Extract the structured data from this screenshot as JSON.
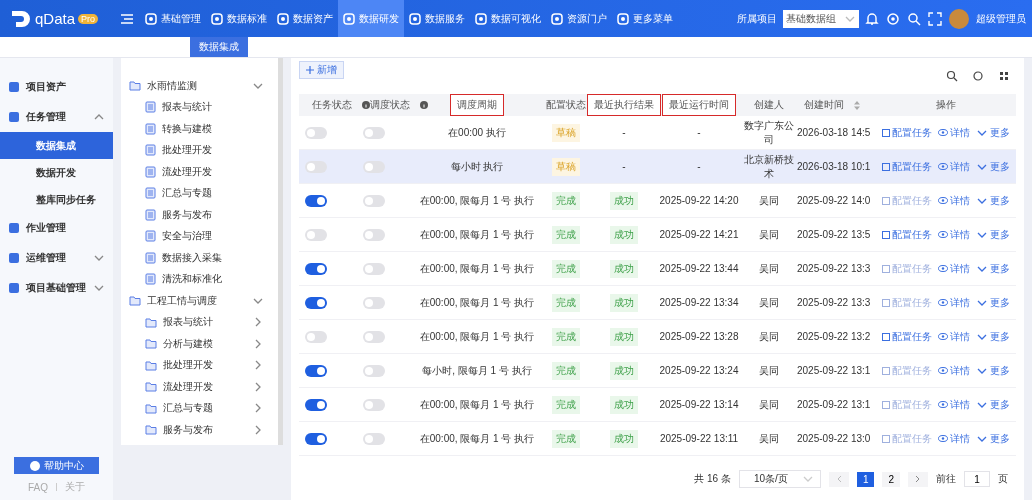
{
  "topbar": {
    "logo": "qData",
    "badge": "Pro",
    "menu": [
      {
        "label": "基础管理",
        "selected": false
      },
      {
        "label": "数据标准",
        "selected": false
      },
      {
        "label": "数据资产",
        "selected": false
      },
      {
        "label": "数据研发",
        "selected": true
      },
      {
        "label": "数据服务",
        "selected": false
      },
      {
        "label": "数据可视化",
        "selected": false
      },
      {
        "label": "资源门户",
        "selected": false
      },
      {
        "label": "更多菜单",
        "selected": false
      }
    ],
    "project_label": "所属项目",
    "project_value": "基础数据组",
    "user": "超级管理员"
  },
  "tabs": [
    {
      "label": "数据集成",
      "selected": true
    }
  ],
  "sidebar": {
    "items": [
      {
        "label": "项目资产"
      },
      {
        "label": "任务管理",
        "expanded": true,
        "children": [
          {
            "label": "数据集成",
            "selected": true
          },
          {
            "label": "数据开发",
            "selected": false
          },
          {
            "label": "整库同步任务",
            "selected": false
          }
        ]
      },
      {
        "label": "作业管理"
      },
      {
        "label": "运维管理",
        "expanded": false
      },
      {
        "label": "项目基础管理",
        "expanded": false
      }
    ],
    "help_button": "帮助中心",
    "links": [
      "FAQ",
      "关于"
    ]
  },
  "tree": [
    {
      "label": "水雨情监测",
      "kind": "folder",
      "expanded": true,
      "children": [
        {
          "label": "报表与统计",
          "kind": "file"
        },
        {
          "label": "转换与建模",
          "kind": "file"
        },
        {
          "label": "批处理开发",
          "kind": "file"
        },
        {
          "label": "流处理开发",
          "kind": "file"
        },
        {
          "label": "汇总与专题",
          "kind": "file"
        },
        {
          "label": "服务与发布",
          "kind": "file"
        },
        {
          "label": "安全与治理",
          "kind": "file"
        },
        {
          "label": "数据接入采集",
          "kind": "file"
        },
        {
          "label": "清洗和标准化",
          "kind": "file"
        }
      ]
    },
    {
      "label": "工程工情与调度",
      "kind": "folder",
      "expanded": true,
      "children": [
        {
          "label": "报表与统计",
          "kind": "folder",
          "expanded": false
        },
        {
          "label": "分析与建模",
          "kind": "folder",
          "expanded": false
        },
        {
          "label": "批处理开发",
          "kind": "folder",
          "expanded": false
        },
        {
          "label": "流处理开发",
          "kind": "folder",
          "expanded": false
        },
        {
          "label": "汇总与专题",
          "kind": "folder",
          "expanded": false
        },
        {
          "label": "服务与发布",
          "kind": "folder",
          "expanded": false
        }
      ]
    }
  ],
  "add_button": "新增",
  "table": {
    "columns": [
      {
        "label": "任务状态",
        "info": true,
        "highlighted": false
      },
      {
        "label": "调度状态",
        "info": true,
        "highlighted": false
      },
      {
        "label": "调度周期",
        "highlighted": true
      },
      {
        "label": "配置状态",
        "highlighted": false
      },
      {
        "label": "最近执行结果",
        "highlighted": true
      },
      {
        "label": "最近运行时间",
        "highlighted": true
      },
      {
        "label": "创建人",
        "highlighted": false
      },
      {
        "label": "创建时间",
        "sortable": true,
        "highlighted": false
      },
      {
        "label": "操作",
        "highlighted": false
      }
    ],
    "rows": [
      {
        "selected": false,
        "task_on": false,
        "schedule_on": false,
        "period": "在00:00 执行",
        "config": {
          "text": "草稿",
          "kind": "draft"
        },
        "result": {
          "text": "-",
          "tagged": false
        },
        "run_time": "-",
        "creator": "数字广东公司",
        "created": "2026-03-18 14:5",
        "actions": [
          {
            "label": "配置任务",
            "disabled": false
          },
          {
            "label": "详情"
          },
          {
            "label": "更多"
          }
        ]
      },
      {
        "selected": true,
        "task_on": false,
        "schedule_on": false,
        "period": "每小时 执行",
        "config": {
          "text": "草稿",
          "kind": "draft"
        },
        "result": {
          "text": "-",
          "tagged": false
        },
        "run_time": "-",
        "creator": "北京新桥技术",
        "created": "2026-03-18 10:1",
        "actions": [
          {
            "label": "配置任务",
            "disabled": false
          },
          {
            "label": "详情"
          },
          {
            "label": "更多"
          }
        ]
      },
      {
        "selected": false,
        "task_on": true,
        "schedule_on": false,
        "period": "在00:00, 限每月 1 号 执行",
        "config": {
          "text": "完成",
          "kind": "done"
        },
        "result": {
          "text": "成功",
          "tagged": true
        },
        "run_time": "2025-09-22 14:20",
        "creator": "吴同",
        "created": "2025-09-22 14:0",
        "actions": [
          {
            "label": "配置任务",
            "disabled": true
          },
          {
            "label": "详情"
          },
          {
            "label": "更多"
          }
        ]
      },
      {
        "selected": false,
        "task_on": false,
        "schedule_on": false,
        "period": "在00:00, 限每月 1 号 执行",
        "config": {
          "text": "完成",
          "kind": "done"
        },
        "result": {
          "text": "成功",
          "tagged": true
        },
        "run_time": "2025-09-22 14:21",
        "creator": "吴同",
        "created": "2025-09-22 13:5",
        "actions": [
          {
            "label": "配置任务",
            "disabled": false
          },
          {
            "label": "详情"
          },
          {
            "label": "更多"
          }
        ]
      },
      {
        "selected": false,
        "task_on": true,
        "schedule_on": false,
        "period": "在00:00, 限每月 1 号 执行",
        "config": {
          "text": "完成",
          "kind": "done"
        },
        "result": {
          "text": "成功",
          "tagged": true
        },
        "run_time": "2025-09-22 13:44",
        "creator": "吴同",
        "created": "2025-09-22 13:3",
        "actions": [
          {
            "label": "配置任务",
            "disabled": true
          },
          {
            "label": "详情"
          },
          {
            "label": "更多"
          }
        ]
      },
      {
        "selected": false,
        "task_on": true,
        "schedule_on": false,
        "period": "在00:00, 限每月 1 号 执行",
        "config": {
          "text": "完成",
          "kind": "done"
        },
        "result": {
          "text": "成功",
          "tagged": true
        },
        "run_time": "2025-09-22 13:34",
        "creator": "吴同",
        "created": "2025-09-22 13:3",
        "actions": [
          {
            "label": "配置任务",
            "disabled": true
          },
          {
            "label": "详情"
          },
          {
            "label": "更多"
          }
        ]
      },
      {
        "selected": false,
        "task_on": false,
        "schedule_on": false,
        "period": "在00:00, 限每月 1 号 执行",
        "config": {
          "text": "完成",
          "kind": "done"
        },
        "result": {
          "text": "成功",
          "tagged": true
        },
        "run_time": "2025-09-22 13:28",
        "creator": "吴同",
        "created": "2025-09-22 13:2",
        "actions": [
          {
            "label": "配置任务",
            "disabled": false
          },
          {
            "label": "详情"
          },
          {
            "label": "更多"
          }
        ]
      },
      {
        "selected": false,
        "task_on": true,
        "schedule_on": false,
        "period": "每小时, 限每月 1 号 执行",
        "config": {
          "text": "完成",
          "kind": "done"
        },
        "result": {
          "text": "成功",
          "tagged": true
        },
        "run_time": "2025-09-22 13:24",
        "creator": "吴同",
        "created": "2025-09-22 13:1",
        "actions": [
          {
            "label": "配置任务",
            "disabled": true
          },
          {
            "label": "详情"
          },
          {
            "label": "更多"
          }
        ]
      },
      {
        "selected": false,
        "task_on": true,
        "schedule_on": false,
        "period": "在00:00, 限每月 1 号 执行",
        "config": {
          "text": "完成",
          "kind": "done"
        },
        "result": {
          "text": "成功",
          "tagged": true
        },
        "run_time": "2025-09-22 13:14",
        "creator": "吴同",
        "created": "2025-09-22 13:1",
        "actions": [
          {
            "label": "配置任务",
            "disabled": true
          },
          {
            "label": "详情"
          },
          {
            "label": "更多"
          }
        ]
      },
      {
        "selected": false,
        "task_on": true,
        "schedule_on": false,
        "period": "在00:00, 限每月 1 号 执行",
        "config": {
          "text": "完成",
          "kind": "done"
        },
        "result": {
          "text": "成功",
          "tagged": true
        },
        "run_time": "2025-09-22 13:11",
        "creator": "吴同",
        "created": "2025-09-22 13:0",
        "actions": [
          {
            "label": "配置任务",
            "disabled": true
          },
          {
            "label": "详情"
          },
          {
            "label": "更多"
          }
        ]
      }
    ]
  },
  "pagination": {
    "total": "共 16 条",
    "page_size": "10条/页",
    "pages": [
      {
        "label": "1",
        "selected": true
      },
      {
        "label": "2",
        "selected": false
      }
    ],
    "goto_label": "前往",
    "goto_value": "1",
    "goto_suffix": "页"
  }
}
